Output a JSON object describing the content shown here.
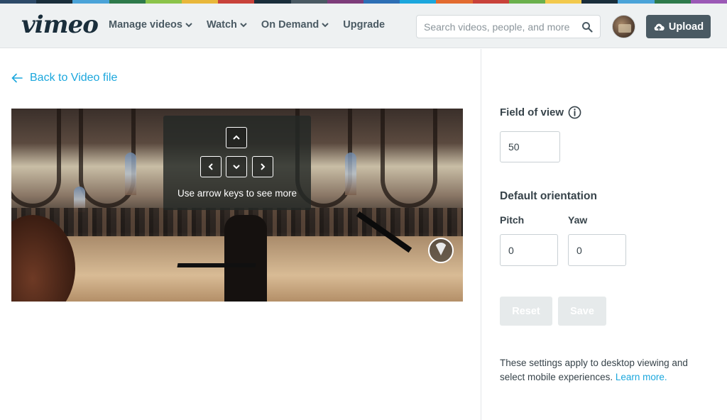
{
  "header": {
    "logo": "vimeo",
    "nav": [
      {
        "label": "Manage videos",
        "has_dropdown": true
      },
      {
        "label": "Watch",
        "has_dropdown": true
      },
      {
        "label": "On Demand",
        "has_dropdown": true
      },
      {
        "label": "Upgrade",
        "has_dropdown": false
      }
    ],
    "search_placeholder": "Search videos, people, and more",
    "upload_label": "Upload",
    "strip_colors": [
      "#2d4a68",
      "#1a2e3b",
      "#4aa3d8",
      "#2e7a4b",
      "#8bc34a",
      "#e8b73a",
      "#c8423a",
      "#1a2e3b",
      "#4a5a63",
      "#7d3c7a",
      "#2d6fb5",
      "#1ba7dd",
      "#e26b2f",
      "#c8423a",
      "#6ab04c",
      "#f2c94c",
      "#1a2e3b",
      "#4aa3d8",
      "#2e7a4b",
      "#9b59b6"
    ]
  },
  "back_link": "Back to Video file",
  "video": {
    "overlay_text": "Use arrow keys to see more"
  },
  "settings": {
    "field_of_view_label": "Field of view",
    "field_of_view_value": "50",
    "default_orientation_label": "Default orientation",
    "pitch_label": "Pitch",
    "pitch_value": "0",
    "yaw_label": "Yaw",
    "yaw_value": "0",
    "reset_label": "Reset",
    "save_label": "Save",
    "help_text": "These settings apply to desktop viewing and select mobile experiences.",
    "help_link": "Learn more."
  },
  "colors": {
    "accent": "#1ba7dd",
    "upload_bg": "#4a5a63",
    "text_dark": "#37434a"
  }
}
